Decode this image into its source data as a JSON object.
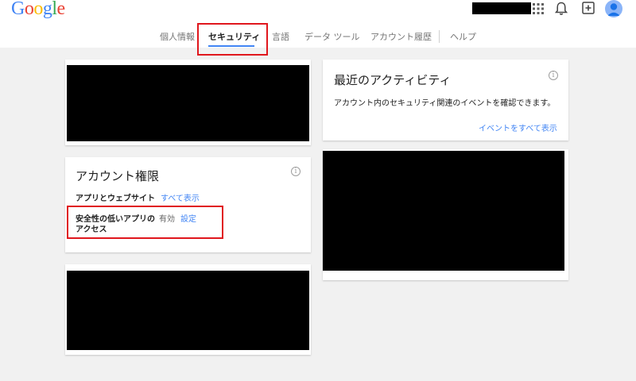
{
  "header": {
    "logo": [
      "G",
      "o",
      "o",
      "g",
      "l",
      "e"
    ],
    "logo_colors": [
      "#4285f4",
      "#ea4335",
      "#fbbc05",
      "#4285f4",
      "#34a853",
      "#ea4335"
    ],
    "icons": [
      "apps-grid-icon",
      "notifications-bell-icon",
      "add-post-icon",
      "account-avatar-icon"
    ]
  },
  "tabs": {
    "items": [
      "個人情報",
      "セキュリティ",
      "言語",
      "データ ツール",
      "アカウント履歴",
      "ヘルプ"
    ],
    "active": "セキュリティ"
  },
  "account_permissions": {
    "title": "アカウント権限",
    "apps_label": "アプリとウェブサイト",
    "apps_link": "すべて表示",
    "less_secure_label_line1": "安全性の低いアプリの",
    "less_secure_label_line2": "アクセス",
    "less_secure_status": "有効",
    "less_secure_link": "設定"
  },
  "recent_activity": {
    "title": "最近のアクティビティ",
    "description": "アカウント内のセキュリティ関連のイベントを確認できます。",
    "link": "イベントをすべて表示"
  },
  "info_glyph": "i",
  "colors": {
    "accent": "#4285f4",
    "highlight": "#e0171d",
    "background": "#f1f1f1"
  }
}
